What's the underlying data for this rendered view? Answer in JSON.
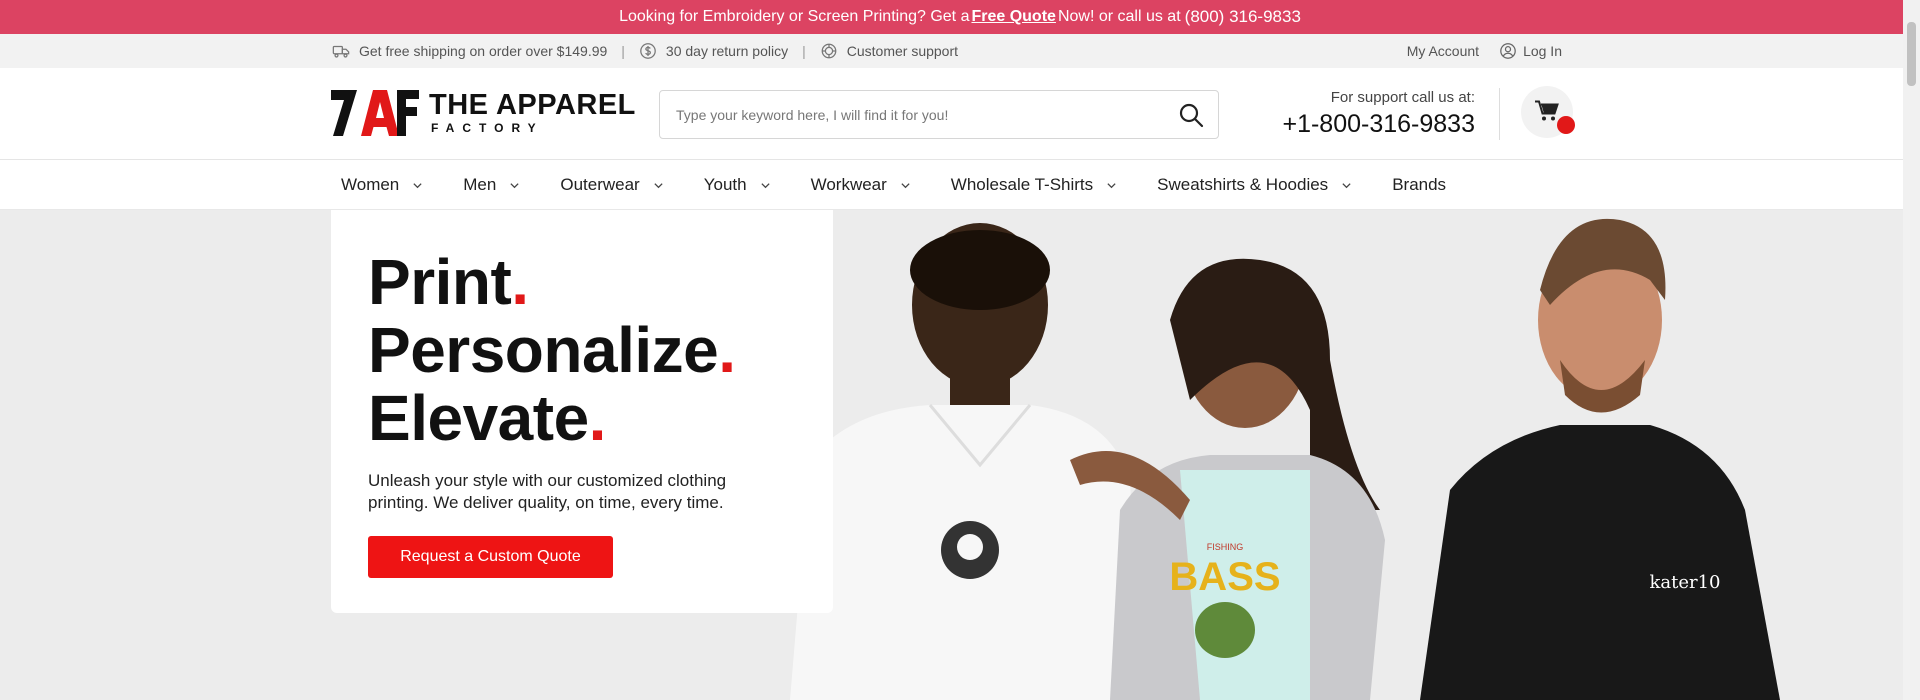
{
  "announcement": {
    "prefix": "Looking for Embroidery or Screen Printing? Get a",
    "link": "Free Quote",
    "suffix": "Now! or call us at",
    "phone": "(800) 316-9833"
  },
  "utility": {
    "shipping": "Get free shipping on order over $149.99",
    "returns": "30 day return policy",
    "support": "Customer support",
    "account": "My Account",
    "login": "Log In"
  },
  "header": {
    "logo_mark": "7AF",
    "logo_line1": "THE APPAREL",
    "logo_line2": "FACTORY",
    "search_placeholder": "Type your keyword here, I will find it for you!",
    "support_label": "For support call us at:",
    "support_phone": "+1-800-316-9833"
  },
  "nav": {
    "items": [
      {
        "label": "Women",
        "has_dropdown": true
      },
      {
        "label": "Men",
        "has_dropdown": true
      },
      {
        "label": "Outerwear",
        "has_dropdown": true
      },
      {
        "label": "Youth",
        "has_dropdown": true
      },
      {
        "label": "Workwear",
        "has_dropdown": true
      },
      {
        "label": "Wholesale T-Shirts",
        "has_dropdown": true
      },
      {
        "label": "Sweatshirts & Hoodies",
        "has_dropdown": true
      },
      {
        "label": "Brands",
        "has_dropdown": false
      }
    ]
  },
  "hero": {
    "line1": "Print",
    "line2": "Personalize",
    "line3": "Elevate",
    "dot": ".",
    "description": "Unleash your style with our customized clothing printing. We deliver quality, on time, every time.",
    "cta": "Request a Custom Quote",
    "shirt_brand": "kater10",
    "tee_print_top": "FISHING",
    "tee_print_main": "BASS"
  },
  "colors": {
    "announcement": "#dc4362",
    "accent": "#ee1414",
    "cart_badge": "#e11818"
  }
}
